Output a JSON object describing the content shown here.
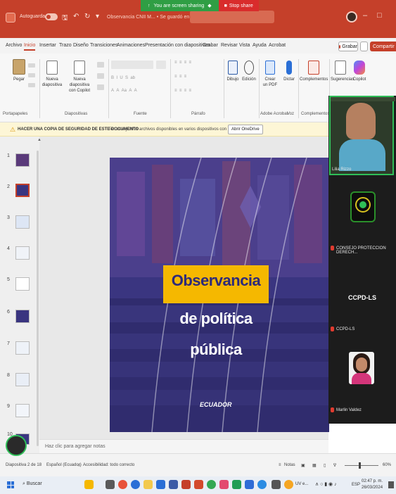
{
  "titlebar": {
    "autosave_label": "Autoguardado",
    "doc_title": "Observancia CNII M... • Se guardó en este PC"
  },
  "screen_share": {
    "sharing_label": "You are screen sharing",
    "stop_label": "Stop share"
  },
  "menu": {
    "tabs": [
      "Archivo",
      "Inicio",
      "Insertar",
      "Trazo",
      "Diseño",
      "Transiciones",
      "Animaciones",
      "Presentación con diapositivas",
      "Grabar",
      "Revisar",
      "Vista",
      "Ayuda",
      "Acrobat"
    ],
    "active_tab": "Inicio",
    "record_label": "Grabar",
    "share_label": "Compartir"
  },
  "ribbon": {
    "paste_label": "Pegar",
    "new_slide_label_1": "Nueva",
    "new_slide_label_2": "diapositiva",
    "copilot_slide_label_1": "Nueva diapositiva",
    "copilot_slide_label_2": "con Copilot",
    "draw_label": "Dibujo",
    "edit_label": "Edición",
    "create_pdf_label_1": "Crear",
    "create_pdf_label_2": "un PDF",
    "dictate_label": "Dictar",
    "addins_label": "Complementos",
    "suggestions_label": "Sugerencias",
    "copilot_label": "Copilot",
    "groups": {
      "clipboard": "Portapapeles",
      "slides": "Diapositivas",
      "font": "Fuente",
      "paragraph": "Párrafo",
      "adobe": "Adobe Acrobat",
      "voice": "Voz",
      "addins": "Complementos"
    }
  },
  "notification": {
    "headline": "HACER UNA COPIA DE SEGURIDAD DE ESTE DOCUMENTO",
    "message": "Ten este y otros archivos disponibles en varios dispositivos con OneDrive.",
    "button": "Abrir OneDrive"
  },
  "thumbnails": [
    "1",
    "2",
    "3",
    "4",
    "5",
    "6",
    "7",
    "8",
    "9",
    "10"
  ],
  "slide": {
    "title_line1": "Observancia",
    "title_line2": "de política",
    "title_line3": "pública",
    "logo_text": "ECUADOR"
  },
  "notes_placeholder": "Haz clic para agregar notas",
  "status": {
    "slide_counter": "Diapositiva 2 de 18",
    "language": "Español (Ecuador)",
    "accessibility": "Accesibilidad: todo correcto",
    "notes": "Notas",
    "zoom": "60%"
  },
  "taskbar": {
    "search": "Buscar",
    "uv_label": "UV e...",
    "lang": "ESP",
    "time": "02:47 p. m.",
    "date": "26/03/2024"
  },
  "participants": [
    {
      "name": "Lilia Rizzo"
    },
    {
      "name": "CONSEJO PROTECCION DERECH..."
    },
    {
      "name": "CCPD-LS",
      "display": "CCPD-LS"
    },
    {
      "name": "Marlin Valdez"
    }
  ],
  "colors": {
    "accent": "#c5402a",
    "slide_bg": "#3a3580",
    "banner": "#f5b800",
    "zoom_green": "#2f9e44"
  }
}
